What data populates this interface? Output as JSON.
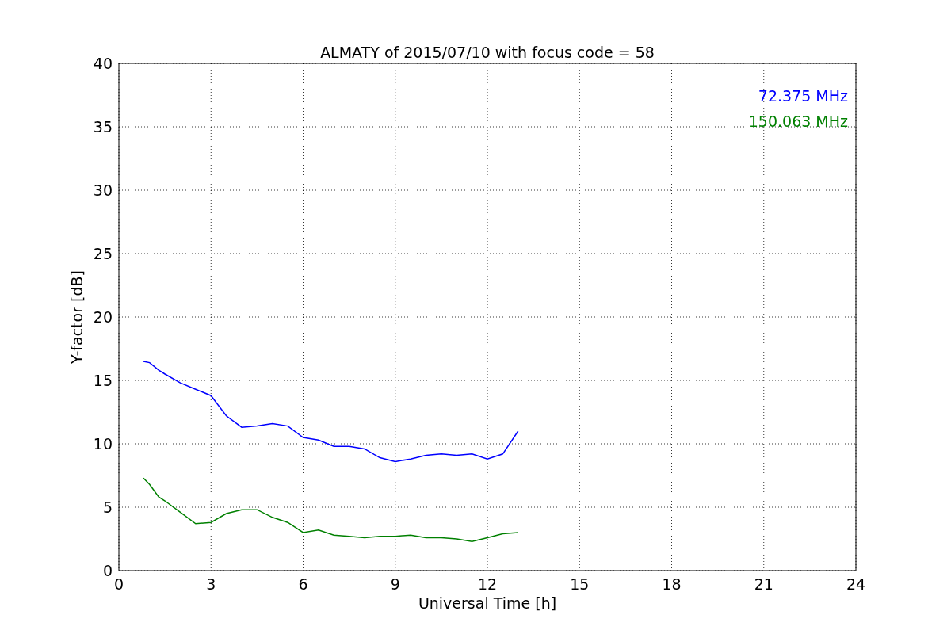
{
  "chart": {
    "chart_data": {
      "type": "line",
      "title": "ALMATY of 2015/07/10 with focus code = 58",
      "xlabel": "Universal Time [h]",
      "ylabel": "Y-factor [dB]",
      "x": [
        0.8,
        1.0,
        1.3,
        1.5,
        2.0,
        2.5,
        3.0,
        3.5,
        4.0,
        4.5,
        5.0,
        5.5,
        6.0,
        6.5,
        7.0,
        7.5,
        8.0,
        8.5,
        9.0,
        9.5,
        10.0,
        10.5,
        11.0,
        11.5,
        12.0,
        12.5,
        13.0
      ],
      "series": [
        {
          "name": "72.375 MHz",
          "color": "#0000ff",
          "values": [
            16.5,
            16.4,
            15.8,
            15.5,
            14.8,
            14.3,
            13.8,
            12.2,
            11.3,
            11.4,
            11.6,
            11.4,
            10.5,
            10.3,
            9.8,
            9.8,
            9.6,
            8.9,
            8.6,
            8.8,
            9.1,
            9.2,
            9.1,
            9.2,
            8.8,
            9.2,
            11.0
          ]
        },
        {
          "name": "150.063 MHz",
          "color": "#008000",
          "values": [
            7.3,
            6.8,
            5.8,
            5.5,
            4.6,
            3.7,
            3.8,
            4.5,
            4.8,
            4.8,
            4.2,
            3.8,
            3.0,
            3.2,
            2.8,
            2.7,
            2.6,
            2.7,
            2.7,
            2.8,
            2.6,
            2.6,
            2.5,
            2.3,
            2.6,
            2.9,
            3.0
          ]
        }
      ],
      "xlim": [
        0,
        24
      ],
      "ylim": [
        0,
        40
      ],
      "xticks": [
        0,
        3,
        6,
        9,
        12,
        15,
        18,
        21,
        24
      ],
      "yticks": [
        0,
        5,
        10,
        15,
        20,
        25,
        30,
        35,
        40
      ],
      "grid": true
    }
  }
}
